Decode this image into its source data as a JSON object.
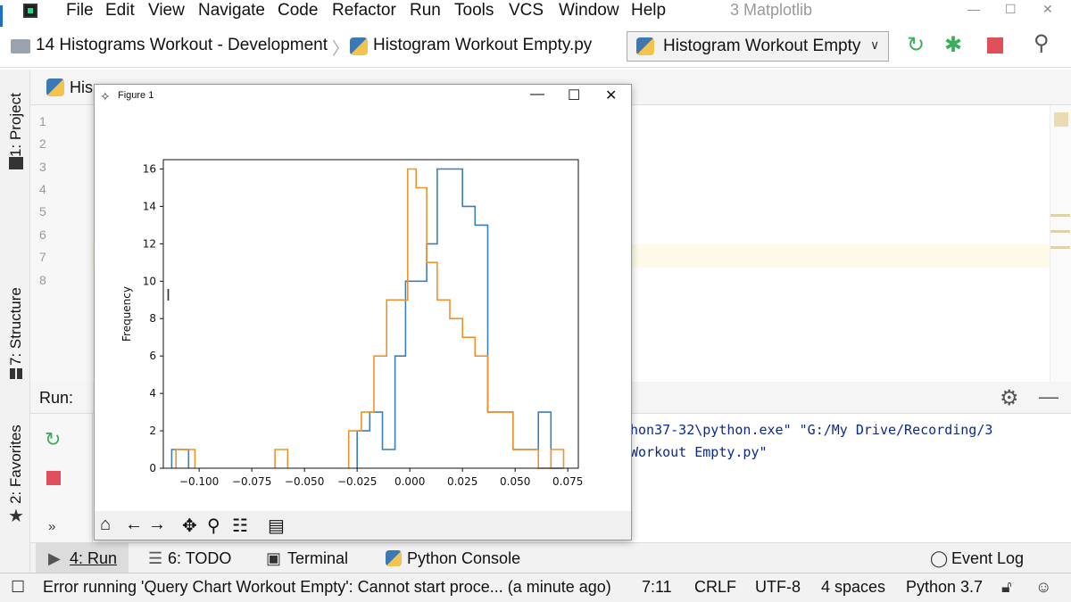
{
  "menu": {
    "items": [
      "File",
      "Edit",
      "View",
      "Navigate",
      "Code",
      "Refactor",
      "Run",
      "Tools",
      "VCS",
      "Window",
      "Help"
    ],
    "project_title": "3 Matplotlib"
  },
  "nav": {
    "project": "14 Histograms Workout  - Development",
    "file": "Histogram Workout Empty.py",
    "run_config": "Histogram Workout Empty"
  },
  "side_tabs": {
    "project": "1: Project",
    "structure": "7: Structure",
    "favorites": "2: Favorites"
  },
  "editor": {
    "tab_label": "His",
    "line_numbers": [
      "1",
      "2",
      "3",
      "4",
      "5",
      "6",
      "7",
      "8"
    ]
  },
  "run_panel": {
    "label": "Run:",
    "console_line1": "hon37-32\\python.exe\" \"G:/My Drive/Recording/3",
    "console_line2": "Workout Empty.py\"",
    "more": "»"
  },
  "bottom_tabs": {
    "run": "4: Run",
    "todo": "6: TODO",
    "terminal": "Terminal",
    "python_console": "Python Console",
    "event_log": "Event Log"
  },
  "status": {
    "message": "Error running 'Query Chart Workout Empty': Cannot start proce... (a minute ago)",
    "position": "7:11",
    "line_sep": "CRLF",
    "encoding": "UTF-8",
    "indent": "4 spaces",
    "interpreter": "Python 3.7"
  },
  "figure": {
    "title": "Figure 1"
  },
  "colors": {
    "blue": "#3a7fb8",
    "orange": "#f0922c",
    "stop": "#e0505a",
    "run_green": "#3cae5a"
  },
  "chart_data": {
    "type": "bar",
    "histtype": "step",
    "title": "",
    "xlabel": "",
    "ylabel": "Frequency",
    "xlim": [
      -0.117,
      0.08
    ],
    "ylim": [
      0,
      16.5
    ],
    "xticks": [
      "−0.100",
      "−0.075",
      "−0.050",
      "−0.025",
      "0.000",
      "0.025",
      "0.050",
      "0.075"
    ],
    "xtick_values": [
      -0.1,
      -0.075,
      -0.05,
      -0.025,
      0.0,
      0.025,
      0.05,
      0.075
    ],
    "yticks": [
      "0",
      "2",
      "4",
      "6",
      "8",
      "10",
      "12",
      "14",
      "16"
    ],
    "ytick_values": [
      0,
      2,
      4,
      6,
      8,
      10,
      12,
      14,
      16
    ],
    "series": [
      {
        "color": "#3a7fb8",
        "bins": [
          [
            -0.113,
            -0.109,
            1
          ],
          [
            -0.109,
            -0.105,
            1
          ],
          [
            -0.025,
            -0.019,
            2
          ],
          [
            -0.019,
            -0.013,
            3
          ],
          [
            -0.013,
            -0.007,
            1
          ],
          [
            -0.007,
            -0.002,
            6
          ],
          [
            -0.002,
            0.002,
            10
          ],
          [
            0.002,
            0.008,
            10
          ],
          [
            0.008,
            0.013,
            12
          ],
          [
            0.013,
            0.019,
            16
          ],
          [
            0.019,
            0.025,
            16
          ],
          [
            0.025,
            0.031,
            14
          ],
          [
            0.031,
            0.037,
            13
          ],
          [
            0.037,
            0.043,
            3
          ],
          [
            0.043,
            0.049,
            3
          ],
          [
            0.049,
            0.055,
            1
          ],
          [
            0.055,
            0.061,
            1
          ],
          [
            0.061,
            0.067,
            3
          ],
          [
            0.067,
            0.073,
            0
          ]
        ]
      },
      {
        "color": "#f0922c",
        "bins": [
          [
            -0.111,
            -0.107,
            1
          ],
          [
            -0.107,
            -0.102,
            1
          ],
          [
            -0.064,
            -0.058,
            1
          ],
          [
            -0.029,
            -0.023,
            2
          ],
          [
            -0.023,
            -0.017,
            3
          ],
          [
            -0.017,
            -0.011,
            6
          ],
          [
            -0.011,
            -0.005,
            9
          ],
          [
            -0.005,
            -0.001,
            9
          ],
          [
            -0.001,
            0.003,
            16
          ],
          [
            0.003,
            0.008,
            15
          ],
          [
            0.008,
            0.013,
            11
          ],
          [
            0.013,
            0.019,
            9
          ],
          [
            0.019,
            0.025,
            8
          ],
          [
            0.025,
            0.031,
            7
          ],
          [
            0.031,
            0.037,
            6
          ],
          [
            0.037,
            0.043,
            3
          ],
          [
            0.043,
            0.049,
            3
          ],
          [
            0.049,
            0.055,
            1
          ],
          [
            0.055,
            0.061,
            1
          ],
          [
            0.061,
            0.067,
            0
          ],
          [
            0.067,
            0.073,
            1
          ]
        ]
      }
    ]
  }
}
